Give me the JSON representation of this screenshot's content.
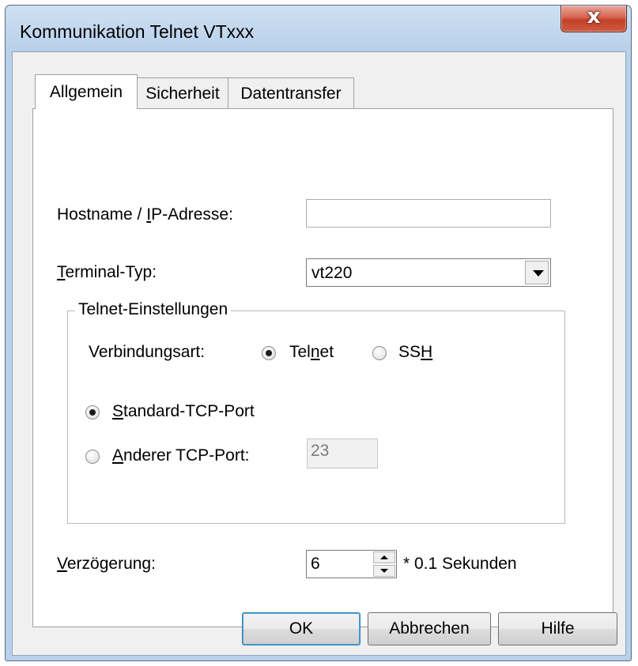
{
  "window": {
    "title": "Kommunikation Telnet VTxxx",
    "close_glyph": "x"
  },
  "tabs": [
    {
      "label": "Allgemein",
      "active": true
    },
    {
      "label": "Sicherheit",
      "active": false
    },
    {
      "label": "Datentransfer",
      "active": false
    }
  ],
  "general": {
    "hostname_label_pre": "Hostname / ",
    "hostname_label_u": "I",
    "hostname_label_post": "P-Adresse:",
    "hostname_value": "",
    "terminal_label_u": "T",
    "terminal_label_post": "erminal-Typ:",
    "terminal_value": "vt220"
  },
  "telnet_group": {
    "legend": "Telnet-Einstellungen",
    "connection_label": "Verbindungsart:",
    "telnet_pre": "Tel",
    "telnet_u": "n",
    "telnet_post": "et",
    "ssh_pre": "SS",
    "ssh_u": "H",
    "selected_connection": "Telnet",
    "standard_port_u": "S",
    "standard_port_post": "tandard-TCP-Port",
    "other_port_u": "A",
    "other_port_post": "nderer TCP-Port:",
    "selected_port_option": "Standard-TCP-Port",
    "port_value": "23"
  },
  "delay": {
    "label_u": "V",
    "label_post": "erzögerung:",
    "value": "6",
    "unit": "* 0.1 Sekunden"
  },
  "buttons": {
    "ok": "OK",
    "cancel": "Abbrechen",
    "help": "Hilfe"
  }
}
